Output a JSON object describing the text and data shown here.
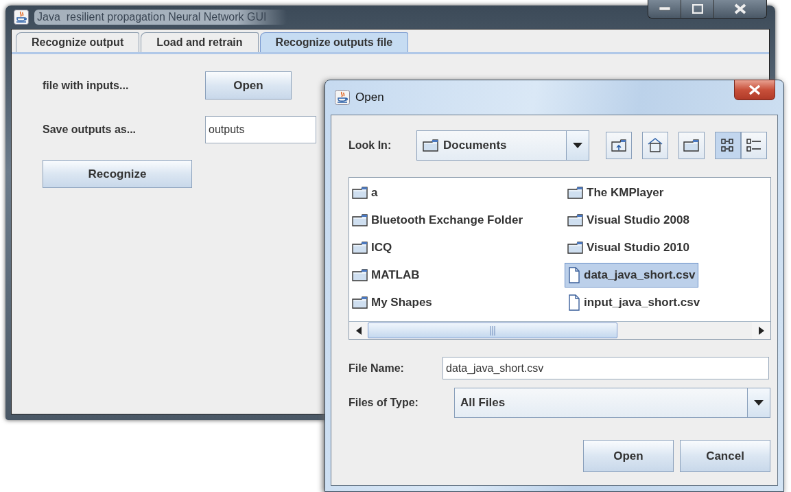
{
  "main_window": {
    "title": "Java  resilient propagation Neural Network GUI",
    "tabs": [
      {
        "label": "Recognize output",
        "selected": false
      },
      {
        "label": "Load and retrain",
        "selected": false
      },
      {
        "label": "Recognize outputs file",
        "selected": true
      }
    ],
    "form": {
      "inputs_label": "file with inputs...",
      "open_button": "Open",
      "save_label": "Save outputs as...",
      "save_value": "outputs",
      "recognize_button": "Recognize"
    }
  },
  "dialog": {
    "title": "Open",
    "look_in_label": "Look In:",
    "look_in_value": "Documents",
    "view_modes": [
      {
        "kind": "list",
        "selected": true
      },
      {
        "kind": "details",
        "selected": false
      }
    ],
    "files": [
      {
        "name": "a",
        "kind": "folder",
        "selected": false
      },
      {
        "name": "Bluetooth Exchange Folder",
        "kind": "folder",
        "selected": false
      },
      {
        "name": "ICQ",
        "kind": "folder",
        "selected": false
      },
      {
        "name": "MATLAB",
        "kind": "folder",
        "selected": false
      },
      {
        "name": "My Shapes",
        "kind": "folder",
        "selected": false
      },
      {
        "name": "The KMPlayer",
        "kind": "folder",
        "selected": false
      },
      {
        "name": "Visual Studio 2008",
        "kind": "folder",
        "selected": false
      },
      {
        "name": "Visual Studio 2010",
        "kind": "folder",
        "selected": false
      },
      {
        "name": "data_java_short.csv",
        "kind": "file",
        "selected": true
      },
      {
        "name": "input_java_short.csv",
        "kind": "file",
        "selected": false
      }
    ],
    "file_name_label": "File Name:",
    "file_name_value": "data_java_short.csv",
    "file_type_label": "Files of Type:",
    "file_type_value": "All Files",
    "buttons": [
      "Open",
      "Cancel"
    ]
  }
}
